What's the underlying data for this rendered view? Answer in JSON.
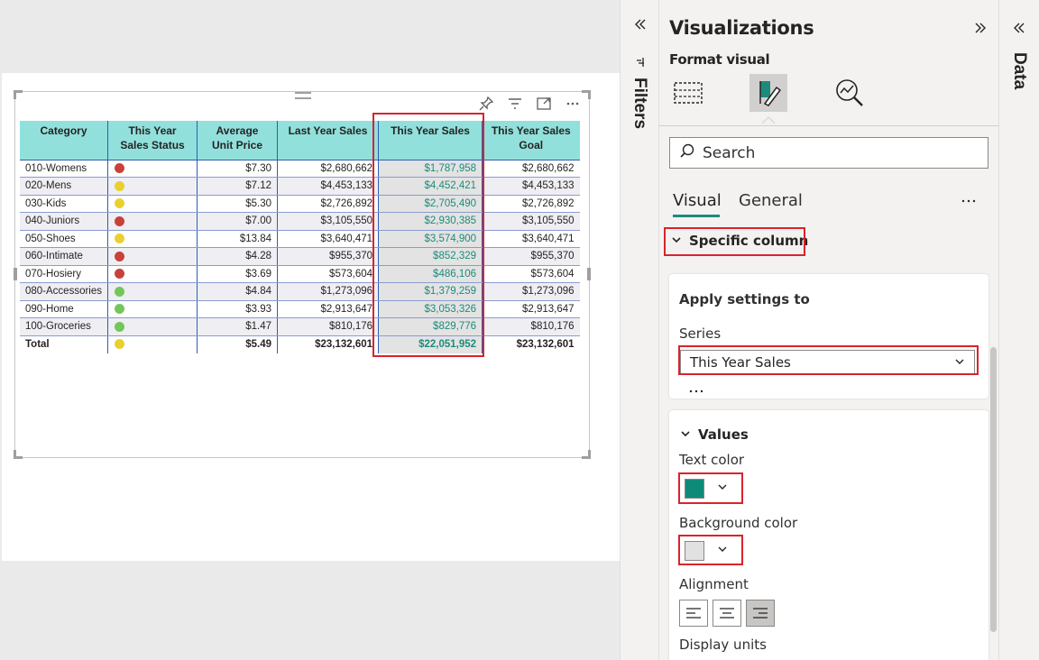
{
  "table": {
    "headers": [
      [
        "Category"
      ],
      [
        "This Year",
        "Sales Status"
      ],
      [
        "Average",
        "Unit Price"
      ],
      [
        "Last Year Sales"
      ],
      [
        "This Year Sales"
      ],
      [
        "This Year Sales",
        "Goal"
      ]
    ],
    "rows": [
      {
        "category": "010-Womens",
        "status": "red",
        "avg_price": "$7.30",
        "last_year": "$2,680,662",
        "this_year": "$1,787,958",
        "goal": "$2,680,662"
      },
      {
        "category": "020-Mens",
        "status": "yellow",
        "avg_price": "$7.12",
        "last_year": "$4,453,133",
        "this_year": "$4,452,421",
        "goal": "$4,453,133"
      },
      {
        "category": "030-Kids",
        "status": "yellow",
        "avg_price": "$5.30",
        "last_year": "$2,726,892",
        "this_year": "$2,705,490",
        "goal": "$2,726,892"
      },
      {
        "category": "040-Juniors",
        "status": "red",
        "avg_price": "$7.00",
        "last_year": "$3,105,550",
        "this_year": "$2,930,385",
        "goal": "$3,105,550"
      },
      {
        "category": "050-Shoes",
        "status": "yellow",
        "avg_price": "$13.84",
        "last_year": "$3,640,471",
        "this_year": "$3,574,900",
        "goal": "$3,640,471"
      },
      {
        "category": "060-Intimate",
        "status": "red",
        "avg_price": "$4.28",
        "last_year": "$955,370",
        "this_year": "$852,329",
        "goal": "$955,370"
      },
      {
        "category": "070-Hosiery",
        "status": "red",
        "avg_price": "$3.69",
        "last_year": "$573,604",
        "this_year": "$486,106",
        "goal": "$573,604"
      },
      {
        "category": "080-Accessories",
        "status": "green",
        "avg_price": "$4.84",
        "last_year": "$1,273,096",
        "this_year": "$1,379,259",
        "goal": "$1,273,096"
      },
      {
        "category": "090-Home",
        "status": "green",
        "avg_price": "$3.93",
        "last_year": "$2,913,647",
        "this_year": "$3,053,326",
        "goal": "$2,913,647"
      },
      {
        "category": "100-Groceries",
        "status": "green",
        "avg_price": "$1.47",
        "last_year": "$810,176",
        "this_year": "$829,776",
        "goal": "$810,176"
      }
    ],
    "total": {
      "category": "Total",
      "status": "yellow",
      "avg_price": "$5.49",
      "last_year": "$23,132,601",
      "this_year": "$22,051,952",
      "goal": "$23,132,601"
    },
    "status_colors": {
      "red": "#c8413a",
      "yellow": "#e8d12e",
      "green": "#74c65a"
    }
  },
  "filters": {
    "label": "Filters"
  },
  "viz": {
    "title": "Visualizations",
    "format_visual": "Format visual",
    "search_placeholder": "Search",
    "tabs": {
      "visual": "Visual",
      "general": "General"
    },
    "specific_column": "Specific column",
    "apply_settings_to": "Apply settings to",
    "series_label": "Series",
    "series_value": "This Year Sales",
    "values_header": "Values",
    "text_color_label": "Text color",
    "text_color": "#0f8a79",
    "background_color_label": "Background color",
    "background_color": "#e1e1e1",
    "alignment_label": "Alignment",
    "display_units_label": "Display units"
  },
  "data_pane": {
    "label": "Data"
  },
  "colors": {
    "accent": "#1d8b7a",
    "highlight_box": "#d9232e",
    "header_fill": "#91e0dc"
  }
}
